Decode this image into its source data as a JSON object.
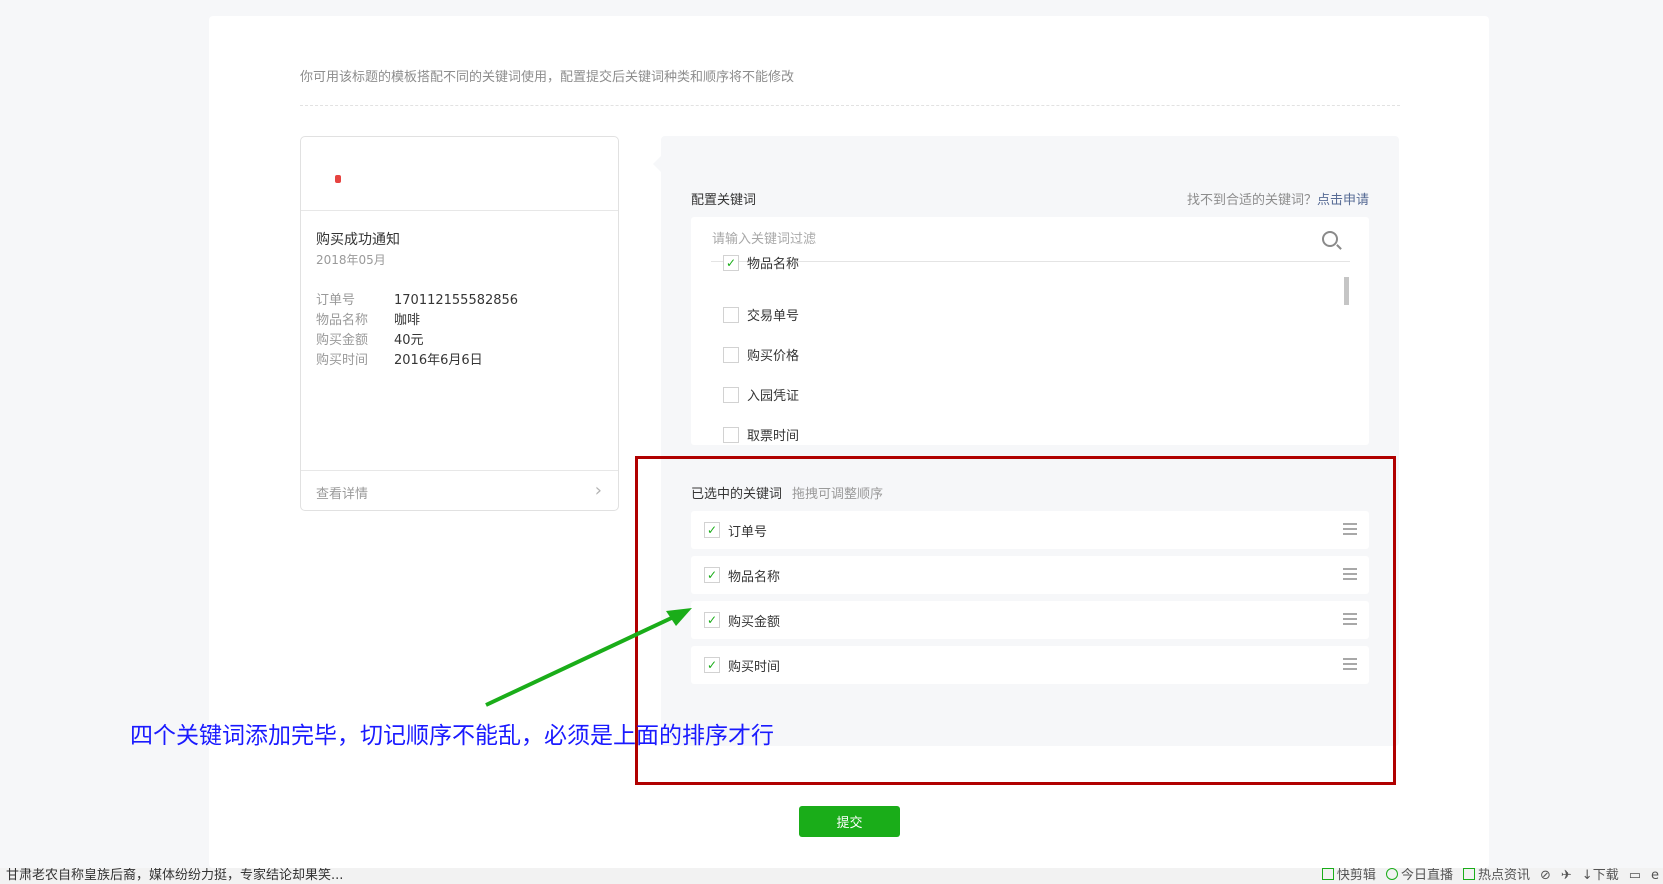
{
  "tip": "你可用该标题的模板搭配不同的关键词使用，配置提交后关键词种类和顺序将不能修改",
  "preview": {
    "title": "购买成功通知",
    "date": "2018年05月",
    "rows": [
      {
        "label": "订单号",
        "value": "170112155582856"
      },
      {
        "label": "物品名称",
        "value": "咖啡"
      },
      {
        "label": "购买金额",
        "value": "40元"
      },
      {
        "label": "购买时间",
        "value": "2016年6月6日"
      }
    ],
    "detail": "查看详情"
  },
  "config": {
    "title": "配置关键词",
    "help": "找不到合适的关键词？",
    "help_link": "点击申请",
    "search_placeholder": "请输入关键词过滤",
    "options": [
      {
        "label": "物品名称",
        "checked": true
      },
      {
        "label": "交易单号",
        "checked": false
      },
      {
        "label": "购买价格",
        "checked": false
      },
      {
        "label": "入园凭证",
        "checked": false
      },
      {
        "label": "取票时间",
        "checked": false
      }
    ]
  },
  "selected": {
    "title": "已选中的关键词",
    "hint": "拖拽可调整顺序",
    "items": [
      "订单号",
      "物品名称",
      "购买金额",
      "购买时间"
    ]
  },
  "annotation": "四个关键词添加完毕，切记顺序不能乱，必须是上面的排序才行",
  "submit": "提交",
  "bottom_bar": {
    "news": "甘肃老农自称皇族后裔，媒体纷纷力挺，专家结论却果笑...",
    "tools": [
      "快剪辑",
      "今日直播",
      "热点资讯",
      "下载"
    ]
  },
  "colors": {
    "accent": "#1aad19",
    "link": "#576b95",
    "annotation": "#1a1aff",
    "highlight": "#b00000"
  }
}
